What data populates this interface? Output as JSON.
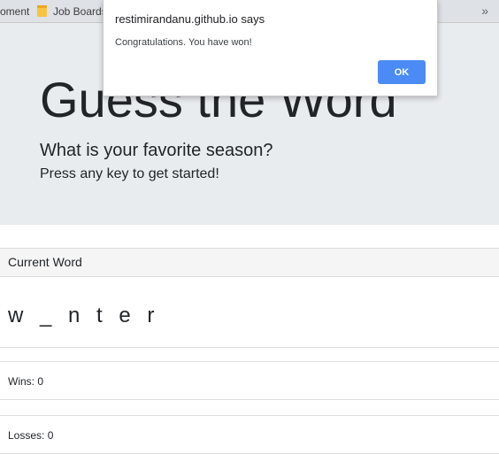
{
  "bookmarks_bar": {
    "partial_item": "oment",
    "items": [
      {
        "label": "Job Boards",
        "icon": "folder-icon"
      }
    ],
    "more_icon": "double-chevron-icon",
    "more_glyph": "»"
  },
  "jumbotron": {
    "title": "Guess the Word",
    "question": "What is your favorite season?",
    "prompt": "Press any key to get started!"
  },
  "current_word": {
    "header": "Current Word",
    "display": "w _ n t e r"
  },
  "stats": {
    "wins": "Wins: 0",
    "losses": "Losses: 0"
  },
  "alert": {
    "title": "restimirandanu.github.io says",
    "message": "Congratulations. You have won!",
    "ok_label": "OK"
  },
  "colors": {
    "jumbotron_bg": "#e9ecef",
    "ok_button": "#4c8bf5",
    "folder_icon": "#f6c343"
  }
}
